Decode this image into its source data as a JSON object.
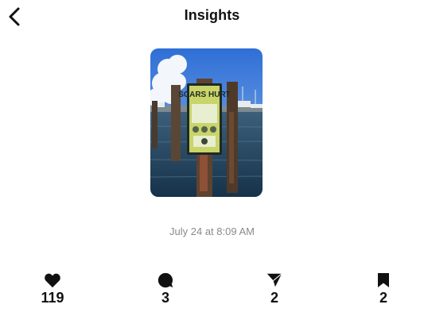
{
  "header": {
    "title": "Insights",
    "back_icon": "chevron-left-icon"
  },
  "post": {
    "image_sign_text": "SCARS HURT",
    "date": "July 24 at 8:09 AM"
  },
  "stats": [
    {
      "name": "likes",
      "icon": "heart-icon",
      "value": "119"
    },
    {
      "name": "comments",
      "icon": "comment-bubble-icon",
      "value": "3"
    },
    {
      "name": "shares",
      "icon": "send-icon",
      "value": "2"
    },
    {
      "name": "saves",
      "icon": "bookmark-icon",
      "value": "2"
    }
  ],
  "colors": {
    "text": "#111111",
    "secondary_text": "#8a8a8a",
    "background": "#ffffff"
  }
}
